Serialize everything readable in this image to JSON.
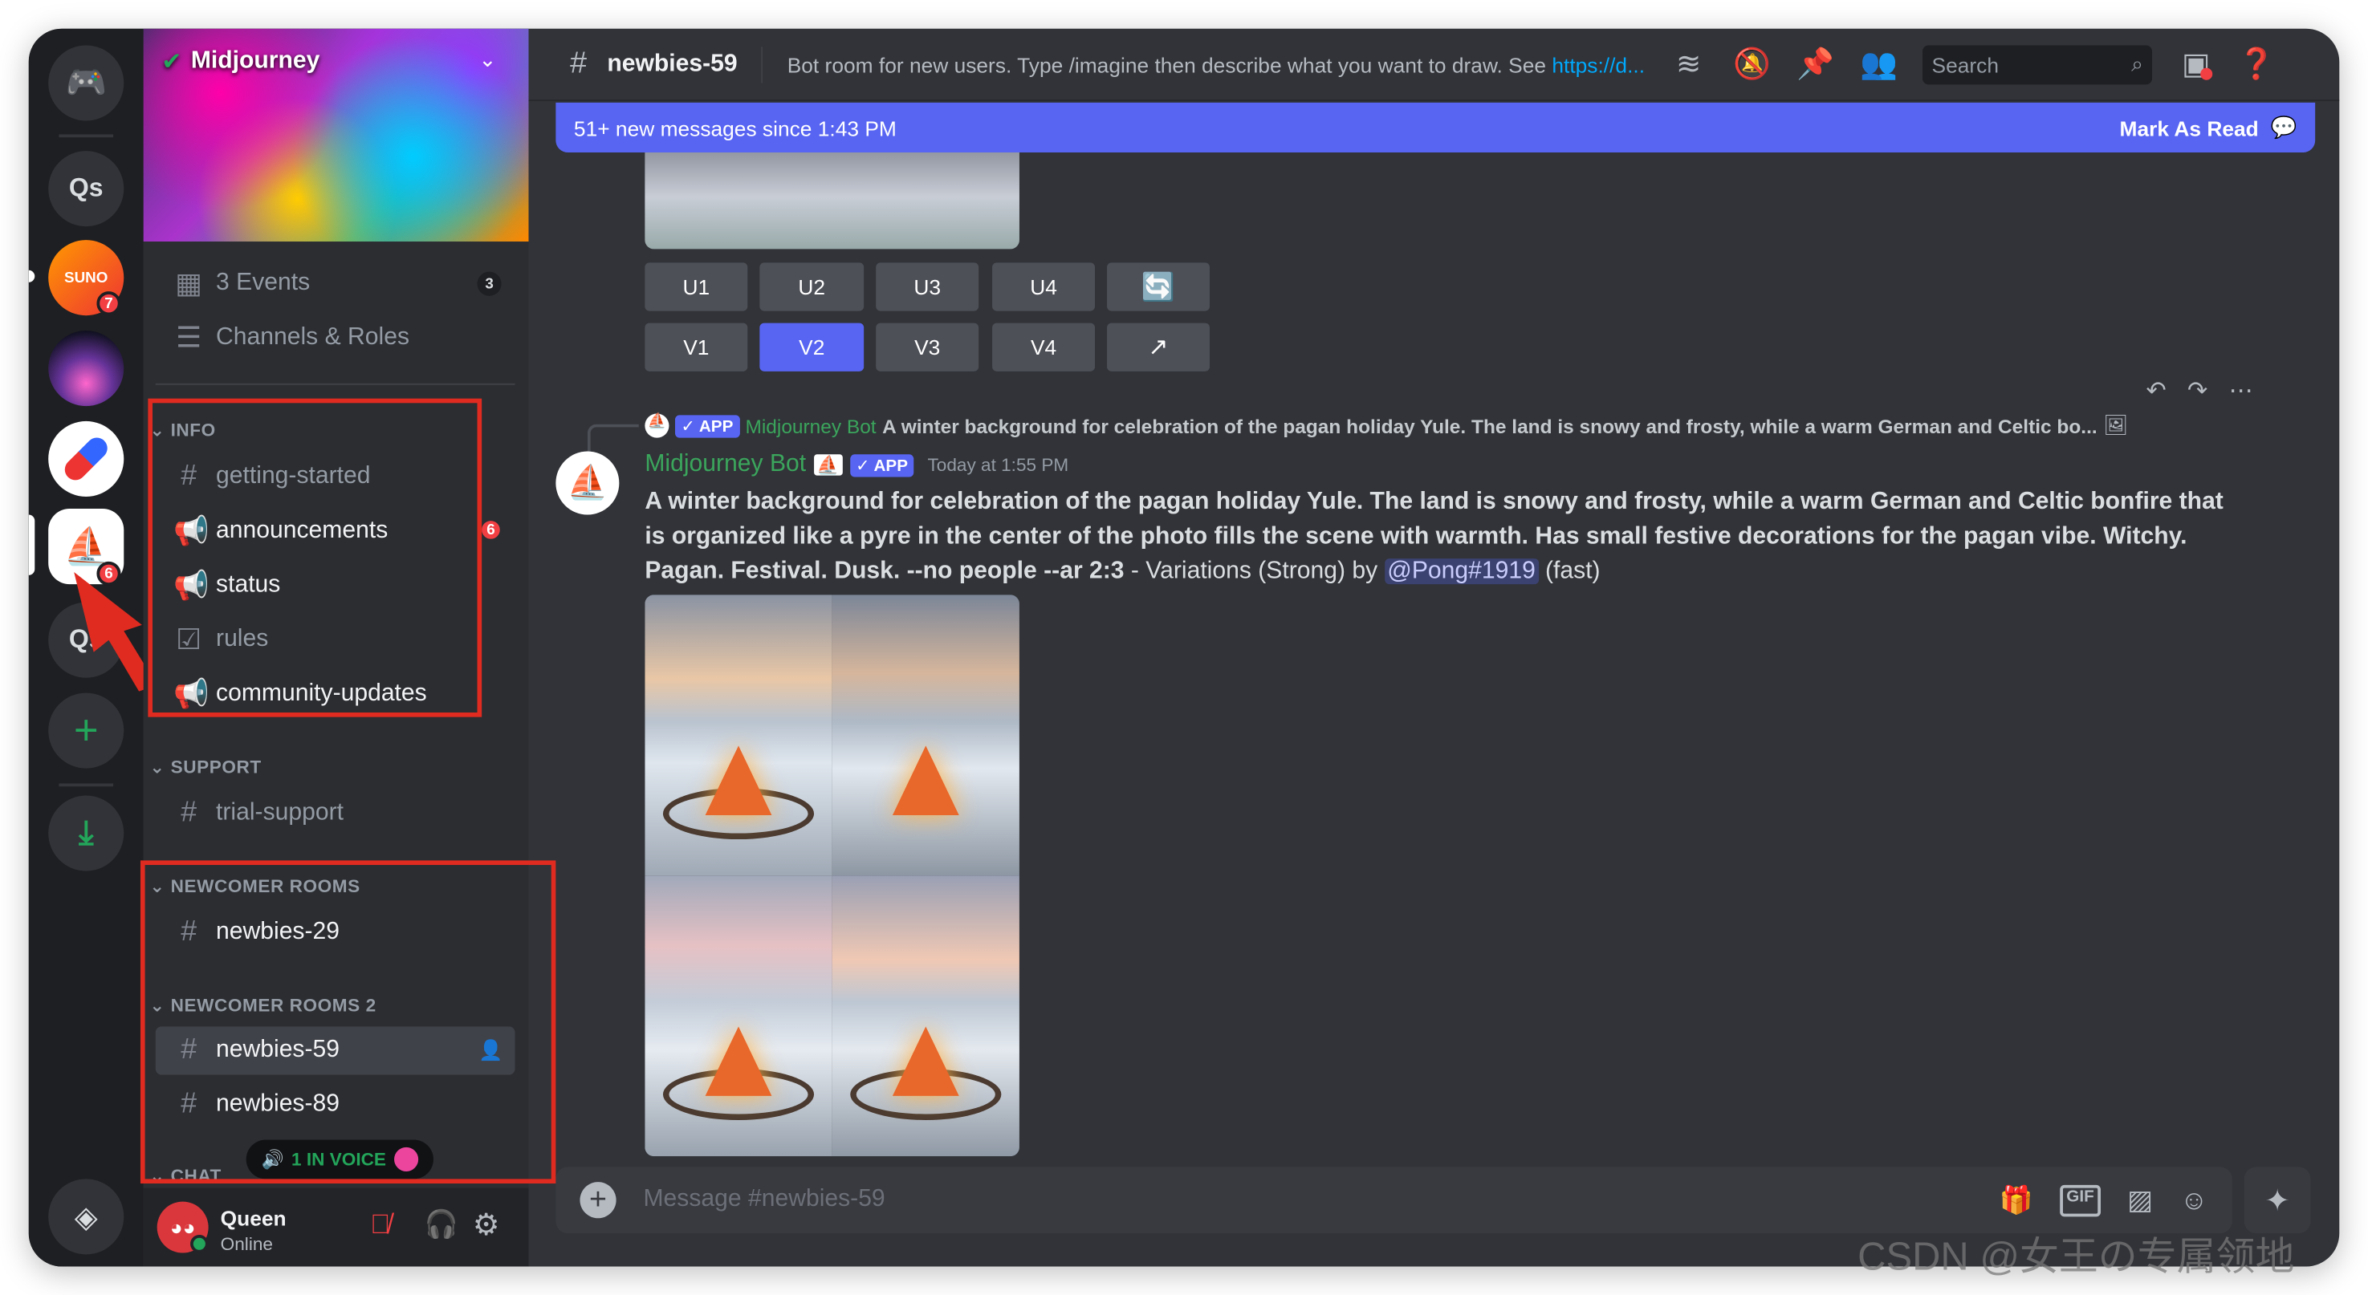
{
  "servers": {
    "items": [
      {
        "label": "Qs"
      },
      {
        "label": "SUNO",
        "badge": "7"
      },
      {
        "label": "Midjourney",
        "badge": "6"
      },
      {
        "label": "Qs"
      }
    ]
  },
  "sidebar": {
    "server_name": "Midjourney",
    "events": {
      "label": "3 Events",
      "count": "3"
    },
    "channels_roles": "Channels & Roles",
    "categories": [
      {
        "name": "INFO",
        "channels": [
          {
            "name": "getting-started"
          },
          {
            "name": "announcements",
            "badge": "6"
          },
          {
            "name": "status"
          },
          {
            "name": "rules"
          },
          {
            "name": "community-updates"
          }
        ]
      },
      {
        "name": "SUPPORT",
        "channels": [
          {
            "name": "trial-support"
          }
        ]
      },
      {
        "name": "NEWCOMER ROOMS",
        "channels": [
          {
            "name": "newbies-29"
          }
        ]
      },
      {
        "name": "NEWCOMER ROOMS 2",
        "channels": [
          {
            "name": "newbies-59"
          },
          {
            "name": "newbies-89"
          }
        ]
      },
      {
        "name": "CHAT"
      }
    ],
    "voice": "1 IN VOICE",
    "user": {
      "name": "Queen",
      "status": "Online"
    }
  },
  "header": {
    "channel": "newbies-59",
    "topic": "Bot room for new users. Type /imagine then describe what you want to draw. See ",
    "topic_link": "https://d...",
    "search_placeholder": "Search"
  },
  "new_messages": {
    "text": "51+ new messages since 1:43 PM",
    "mark_read": "Mark As Read"
  },
  "buttons": {
    "row1": [
      "U1",
      "U2",
      "U3",
      "U4"
    ],
    "row2": [
      "V1",
      "V2",
      "V3",
      "V4"
    ],
    "active": "V2"
  },
  "reply": {
    "app": "APP",
    "author": "Midjourney Bot",
    "text": "A winter background for celebration of the pagan holiday Yule. The land is snowy and frosty, while a warm German and Celtic bo..."
  },
  "message": {
    "author": "Midjourney Bot",
    "app": "APP",
    "timestamp": "Today at 1:55 PM",
    "prompt": "A winter background for celebration of the pagan holiday Yule. The land is snowy and frosty, while a warm German and Celtic bonfire that is organized like a pyre in the center of the photo fills the scene with warmth. Has small festive decorations for the pagan vibe. Witchy. Pagan. Festival. Dusk. --no people --ar 2:3",
    "suffix": " - Variations (Strong) by ",
    "mention": "@Pong#1919",
    "speed": " (fast)"
  },
  "composer": {
    "placeholder": "Message #newbies-59"
  },
  "watermark": "CSDN @女王の专属领地",
  "colors": {
    "blurple": "#5865f2",
    "bot_name": "#3ba55c",
    "annotation": "#e02b20"
  }
}
